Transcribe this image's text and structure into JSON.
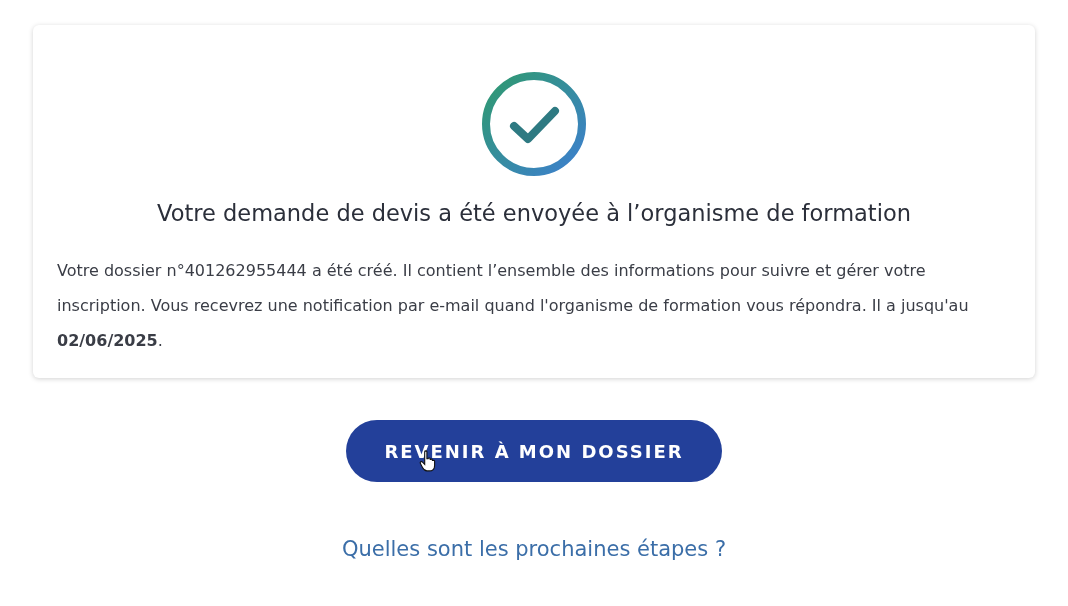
{
  "confirmation": {
    "title": "Votre demande de devis a été envoyée à l’organisme de formation",
    "message": "Votre dossier n°401262955444 a été créé. Il contient l’ensemble des informations pour suivre et gérer votre inscription. Vous recevrez une notification par e-mail quand l'organisme de formation vous répondra. Il a jusqu'au **02/06/2025**."
  },
  "button": {
    "label": "REVENIR À MON DOSSIER"
  },
  "link": {
    "label": "Quelles sont les prochaines étapes ?"
  }
}
